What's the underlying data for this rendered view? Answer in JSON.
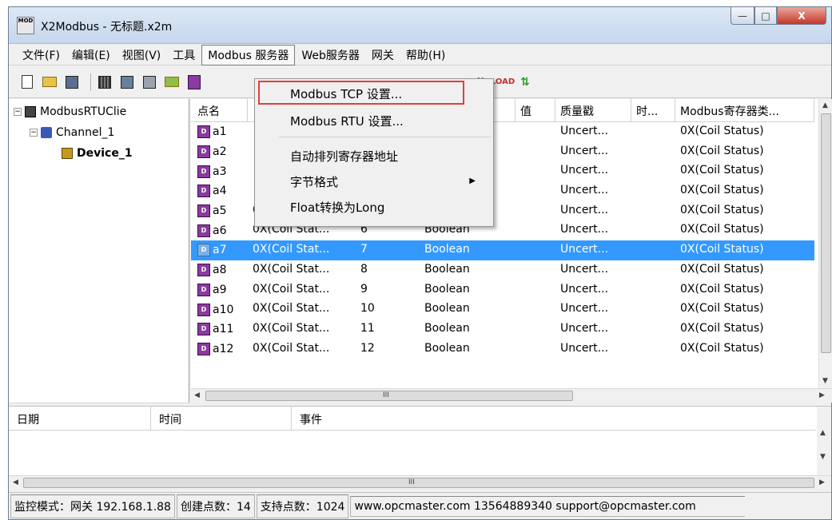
{
  "window": {
    "title": "X2Modbus - 无标题.x2m",
    "app_icon_text": "MOD",
    "min_glyph": "—",
    "max_glyph": "□",
    "close_glyph": "X"
  },
  "menubar": [
    {
      "label": "文件(F)"
    },
    {
      "label": "编辑(E)"
    },
    {
      "label": "视图(V)"
    },
    {
      "label": "工具"
    },
    {
      "label": "Modbus 服务器",
      "active": true
    },
    {
      "label": "Web服务器"
    },
    {
      "label": "网关"
    },
    {
      "label": "帮助(H)"
    }
  ],
  "toolbar": {
    "icons": [
      "new-document-icon",
      "open-folder-icon",
      "save-icon",
      "grid-icon",
      "add-channel-icon",
      "device-icon",
      "add-folder-icon",
      "add-tag-icon",
      "tools-icon",
      "load-icon",
      "up-down-icon"
    ],
    "tools_glyph": "⚒",
    "load_glyph": "LOAD",
    "updown_glyph": "⇅"
  },
  "tree": {
    "root": "ModbusRTUClie",
    "channel": "Channel_1",
    "device": "Device_1",
    "collapse_glyph": "−"
  },
  "table": {
    "columns": [
      "点名",
      "",
      "",
      "",
      "值",
      "质量戳",
      "时...",
      "Modbus寄存器类..."
    ],
    "rows": [
      {
        "name": "a1",
        "type": "",
        "addr": "",
        "datatype": "",
        "value": "",
        "quality": "Uncert...",
        "time": "",
        "reg": "0X(Coil Status)"
      },
      {
        "name": "a2",
        "type": "",
        "addr": "",
        "datatype": "",
        "value": "",
        "quality": "Uncert...",
        "time": "",
        "reg": "0X(Coil Status)"
      },
      {
        "name": "a3",
        "type": "",
        "addr": "",
        "datatype": "",
        "value": "",
        "quality": "Uncert...",
        "time": "",
        "reg": "0X(Coil Status)"
      },
      {
        "name": "a4",
        "type": "",
        "addr": "",
        "datatype": "",
        "value": "",
        "quality": "Uncert...",
        "time": "",
        "reg": "0X(Coil Status)"
      },
      {
        "name": "a5",
        "type": "0X(Coil Stat...",
        "addr": "5",
        "datatype": "Boolean",
        "value": "",
        "quality": "Uncert...",
        "time": "",
        "reg": "0X(Coil Status)"
      },
      {
        "name": "a6",
        "type": "0X(Coil Stat...",
        "addr": "6",
        "datatype": "Boolean",
        "value": "",
        "quality": "Uncert...",
        "time": "",
        "reg": "0X(Coil Status)"
      },
      {
        "name": "a7",
        "type": "0X(Coil Stat...",
        "addr": "7",
        "datatype": "Boolean",
        "value": "",
        "quality": "Uncert...",
        "time": "",
        "reg": "0X(Coil Status)",
        "selected": true
      },
      {
        "name": "a8",
        "type": "0X(Coil Stat...",
        "addr": "8",
        "datatype": "Boolean",
        "value": "",
        "quality": "Uncert...",
        "time": "",
        "reg": "0X(Coil Status)"
      },
      {
        "name": "a9",
        "type": "0X(Coil Stat...",
        "addr": "9",
        "datatype": "Boolean",
        "value": "",
        "quality": "Uncert...",
        "time": "",
        "reg": "0X(Coil Status)"
      },
      {
        "name": "a10",
        "type": "0X(Coil Stat...",
        "addr": "10",
        "datatype": "Boolean",
        "value": "",
        "quality": "Uncert...",
        "time": "",
        "reg": "0X(Coil Status)"
      },
      {
        "name": "a11",
        "type": "0X(Coil Stat...",
        "addr": "11",
        "datatype": "Boolean",
        "value": "",
        "quality": "Uncert...",
        "time": "",
        "reg": "0X(Coil Status)"
      },
      {
        "name": "a12",
        "type": "0X(Coil Stat...",
        "addr": "12",
        "datatype": "Boolean",
        "value": "",
        "quality": "Uncert...",
        "time": "",
        "reg": "0X(Coil Status)"
      }
    ],
    "tag_icon_text": "D"
  },
  "dropdown": {
    "items": [
      {
        "label": "Modbus TCP 设置...",
        "highlighted": true
      },
      {
        "label": "Modbus RTU 设置..."
      },
      {
        "label": "自动排列寄存器地址"
      },
      {
        "label": "字节格式",
        "submenu": true
      },
      {
        "label": "Float转换为Long"
      }
    ],
    "submenu_glyph": "▶"
  },
  "log": {
    "columns": [
      "日期",
      "时间",
      "事件"
    ]
  },
  "scroll": {
    "left": "◀",
    "right": "▶",
    "up": "▲",
    "down": "▼",
    "grip": "III"
  },
  "statusbar": {
    "mode": "监控模式：网关 192.168.1.88",
    "created": "创建点数：14",
    "supported": "支持点数：1024",
    "contact": "www.opcmaster.com 13564889340 support@opcmaster.com"
  }
}
